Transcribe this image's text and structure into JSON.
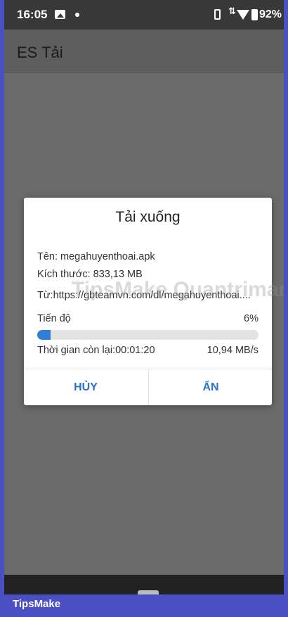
{
  "status_bar": {
    "time": "16:05",
    "battery": "92%",
    "data_icon": "⇅"
  },
  "app_bar": {
    "title": "ES Tải"
  },
  "dialog": {
    "title": "Tải xuống",
    "name_line": "Tên: megahuyenthoai.apk",
    "size_line": "Kích thước: 833,13 MB",
    "source_line": "Từ:https://gbteamvn.com/dl/megahuyenthoai....",
    "progress_label": "Tiến độ",
    "progress_percent": "6%",
    "progress_value": 0.06,
    "time_left": "Thời gian còn lại:00:01:20",
    "speed": "10,94 MB/s",
    "cancel_label": "HỦY",
    "hide_label": "ẨN"
  },
  "watermark": {
    "text": "TipsMake Quantrimang"
  },
  "footer": {
    "brand": "TipsMake"
  },
  "colors": {
    "frame": "#4a4fc4",
    "accent": "#2a72c9",
    "progress_fill": "#2f7fd8",
    "scrim": "#6b6b6b"
  },
  "icons": [
    "gallery-icon",
    "notification-dot-icon",
    "vibrate-icon",
    "data-icon",
    "wifi-icon",
    "battery-icon",
    "nav-home-icon"
  ]
}
